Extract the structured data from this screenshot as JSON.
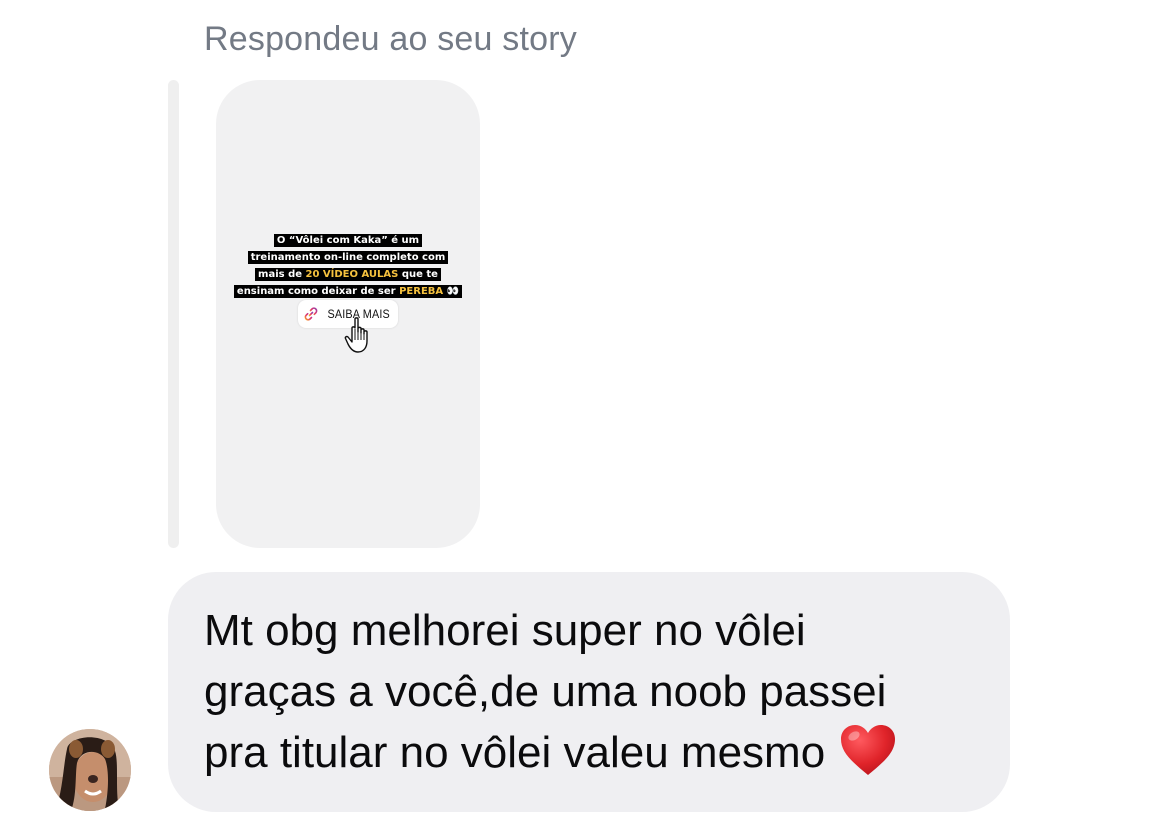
{
  "reply_context": {
    "caption": "Respondeu ao seu story"
  },
  "story": {
    "lines": [
      {
        "pre": "O “Vôlei com Kaka” é um",
        "hl": "",
        "post": ""
      },
      {
        "pre": "treinamento on-line completo com",
        "hl": "",
        "post": ""
      },
      {
        "pre": "mais de ",
        "hl": "20 VÍDEO AULAS",
        "post": " que te"
      },
      {
        "pre": "ensinam como deixar de ser ",
        "hl": "PEREBA",
        "post": " 👀"
      }
    ],
    "link_sticker_label": "SAIBA MAIS",
    "highlight_color": "#f6c23e"
  },
  "message": {
    "lines": [
      "Mt obg melhorei super no vôlei",
      "graças a você,de uma noob passei",
      "pra titular no vôlei valeu mesmo"
    ],
    "emoji": "heart-icon"
  },
  "colors": {
    "bubble": "#efeff2",
    "caption": "#737a85",
    "heart": "#e0242a"
  }
}
